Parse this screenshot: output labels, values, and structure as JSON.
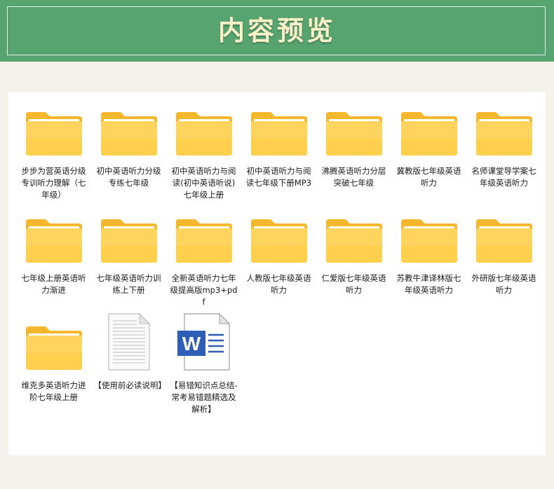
{
  "header": {
    "title": "内容预览"
  },
  "files": [
    {
      "name": "步步为营英语分级专训听力理解（七年级）",
      "icon": "folder-icon"
    },
    {
      "name": "初中英语听力分级专练七年级",
      "icon": "folder-icon"
    },
    {
      "name": "初中英语听力与阅读(初中英语听说)七年级上册",
      "icon": "folder-icon"
    },
    {
      "name": "初中英语听力与阅读七年级下册MP3",
      "icon": "folder-icon"
    },
    {
      "name": "沸腾英语听力分层突破七年级",
      "icon": "folder-icon"
    },
    {
      "name": "冀教版七年级英语听力",
      "icon": "folder-icon"
    },
    {
      "name": "名师课堂导学案七年级英语听力",
      "icon": "folder-icon"
    },
    {
      "name": "七年级上册英语听力渐进",
      "icon": "folder-icon"
    },
    {
      "name": "七年级英语听力训练上下册",
      "icon": "folder-icon"
    },
    {
      "name": "全新英语听力七年级提高版mp3+pdf",
      "icon": "folder-icon"
    },
    {
      "name": "人教版七年级英语听力",
      "icon": "folder-icon"
    },
    {
      "name": "仁爱版七年级英语听力",
      "icon": "folder-icon"
    },
    {
      "name": "苏教牛津译林版七年级英语听力",
      "icon": "folder-icon"
    },
    {
      "name": "外研版七年级英语听力",
      "icon": "folder-icon"
    },
    {
      "name": "维克多英语听力进阶七年级上册",
      "icon": "folder-icon"
    },
    {
      "name": "【使用前必读说明】",
      "icon": "text-document-icon"
    },
    {
      "name": "【易错知识点总结-常考易错题精选及解析】",
      "icon": "word-document-icon"
    }
  ],
  "colors": {
    "header_bg": "#58a470",
    "title_text": "#fbf1c8",
    "folder_back": "#f5b82c",
    "folder_front": "#ffd86a",
    "word_blue": "#2b5eb4"
  }
}
